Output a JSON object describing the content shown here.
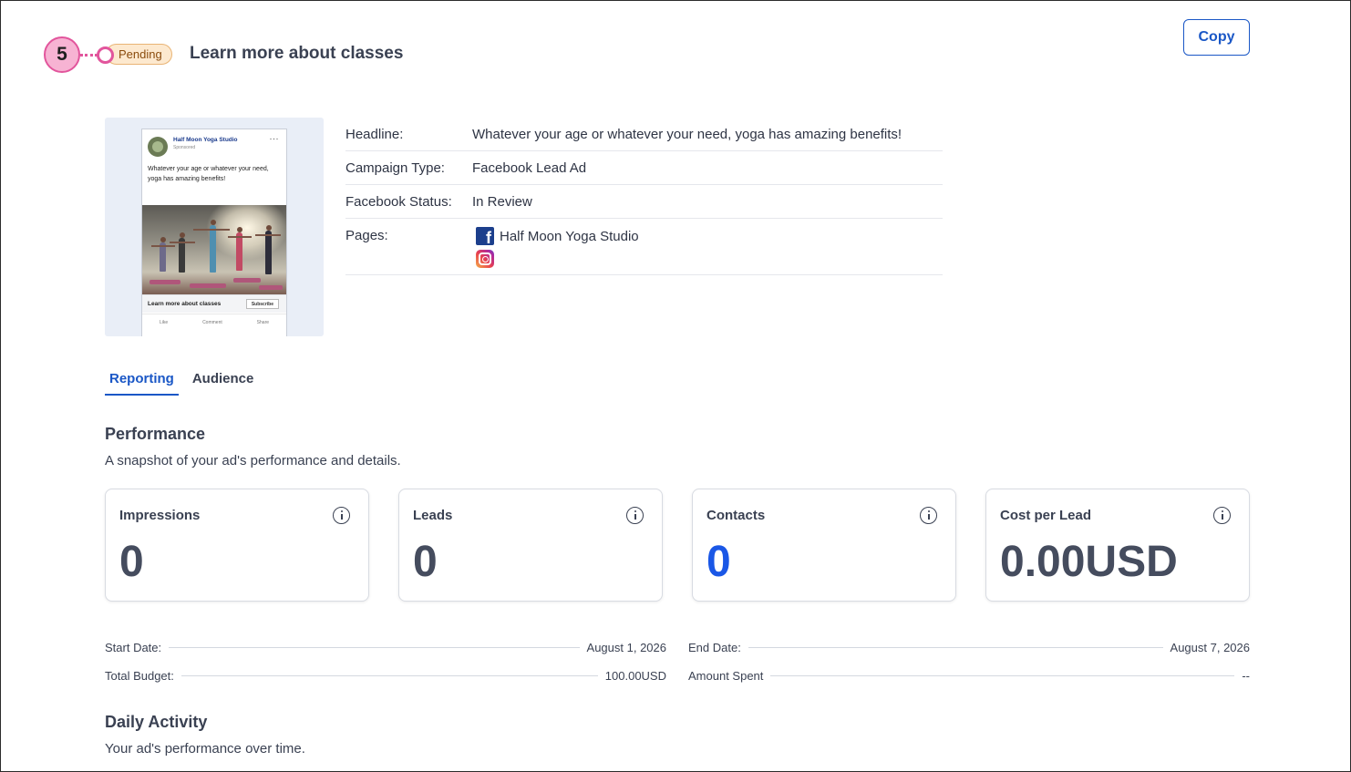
{
  "header": {
    "step_number": "5",
    "status": "Pending",
    "title": "Learn more about classes",
    "copy_label": "Copy"
  },
  "preview": {
    "page_name": "Half Moon Yoga Studio",
    "sponsored": "Sponsored",
    "more": "···",
    "text": "Whatever your age or whatever your need, yoga has amazing benefits!",
    "cta_text": "Learn more about classes",
    "cta_button": "Subscribe",
    "actions": [
      "Like",
      "Comment",
      "Share"
    ]
  },
  "details": {
    "headline_label": "Headline:",
    "headline_value": "Whatever your age or whatever your need, yoga has amazing benefits!",
    "campaign_type_label": "Campaign Type:",
    "campaign_type_value": "Facebook Lead Ad",
    "fb_status_label": "Facebook Status:",
    "fb_status_value": "In Review",
    "pages_label": "Pages:",
    "pages_value": "Half Moon Yoga Studio",
    "page_icons": [
      "facebook-icon",
      "instagram-icon"
    ]
  },
  "tabs": [
    {
      "label": "Reporting",
      "active": true
    },
    {
      "label": "Audience",
      "active": false
    }
  ],
  "performance": {
    "title": "Performance",
    "subtitle": "A snapshot of your ad's performance and details.",
    "cards": [
      {
        "label": "Impressions",
        "value": "0"
      },
      {
        "label": "Leads",
        "value": "0"
      },
      {
        "label": "Contacts",
        "value": "0"
      },
      {
        "label": "Cost per Lead",
        "value": "0.00USD"
      }
    ]
  },
  "stats": {
    "start_date_label": "Start Date:",
    "start_date_value": "August 1, 2026",
    "end_date_label": "End Date:",
    "end_date_value": "August 7, 2026",
    "total_budget_label": "Total Budget:",
    "total_budget_value": "100.00USD",
    "amount_spent_label": "Amount Spent",
    "amount_spent_value": "--"
  },
  "daily": {
    "title": "Daily Activity",
    "subtitle": "Your ad's performance over time."
  },
  "colors": {
    "accent": "#1a57c6",
    "highlight_pink": "#e2559c",
    "pending_bg": "#fde9cf",
    "contacts_blue": "#1a57e6"
  }
}
